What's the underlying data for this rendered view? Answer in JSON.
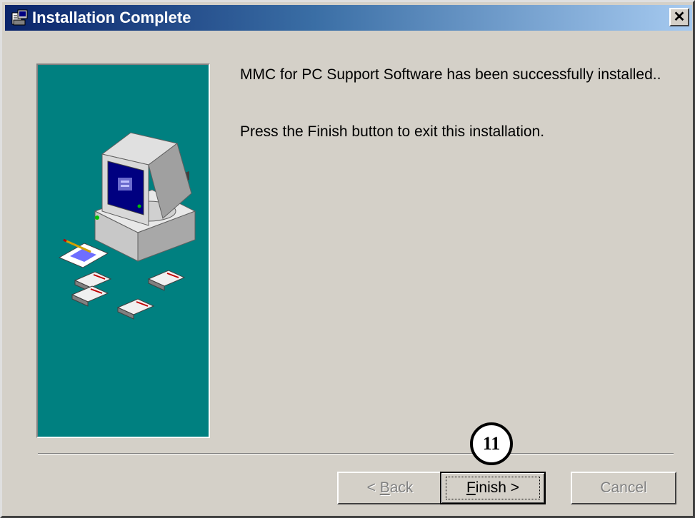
{
  "window": {
    "title": "Installation Complete",
    "close_glyph": "✕"
  },
  "content": {
    "message_success": "MMC for PC Support Software has been successfully installed..",
    "message_instruction": "Press the Finish button to exit this installation."
  },
  "buttons": {
    "back": {
      "prefix": "< ",
      "mnemonic": "B",
      "rest": "ack",
      "enabled": false
    },
    "finish": {
      "mnemonic": "F",
      "rest": "inish >",
      "enabled": true
    },
    "cancel": {
      "label": "Cancel",
      "enabled": false
    }
  },
  "callout": {
    "number": "11"
  },
  "colors": {
    "panel": "#008080",
    "title_start": "#0a246a",
    "title_end": "#a6caf0",
    "face": "#d4d0c8"
  },
  "icons": [
    "setup-app-icon",
    "close-icon",
    "computer-illustration",
    "floppy-disk-icon",
    "notepad-icon"
  ]
}
